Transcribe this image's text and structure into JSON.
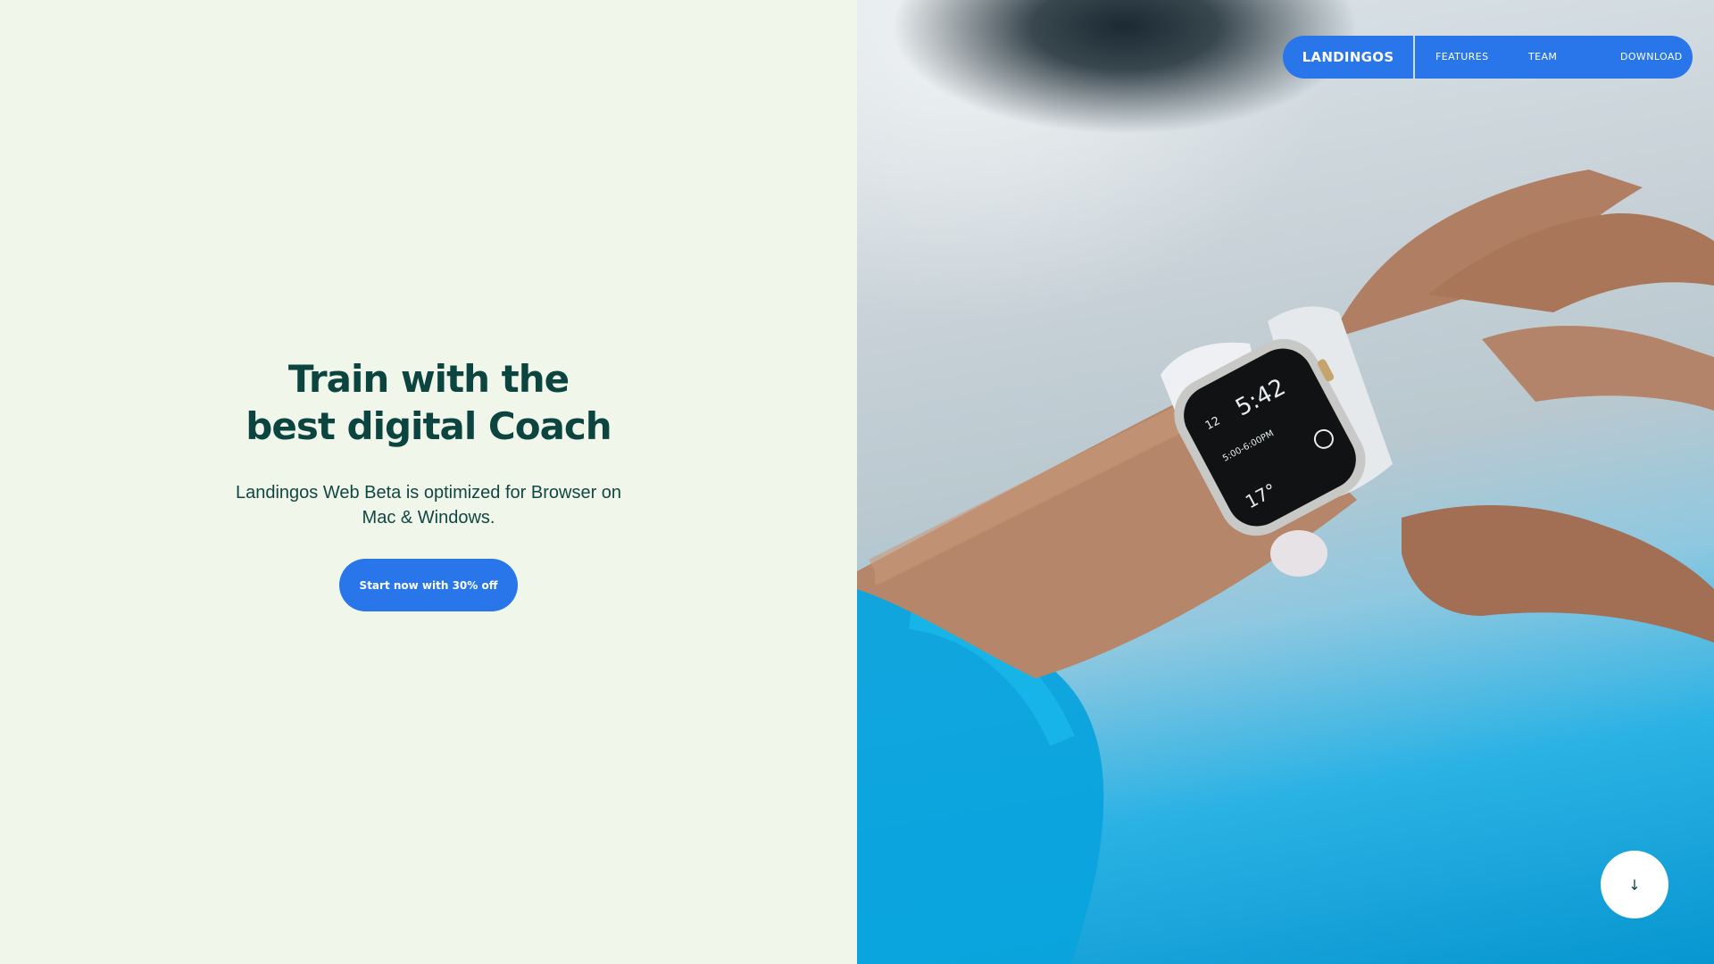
{
  "colors": {
    "left_bg": "#f1f6ea",
    "heading": "#0c4440",
    "accent": "#2876ea",
    "photo_blue": "#0796d0"
  },
  "nav": {
    "brand": "LANDINGOS",
    "features": "FEATURES",
    "team": "TEAM",
    "download": "DOWNLOAD"
  },
  "hero": {
    "title_line1": "Train with the",
    "title_line2": "best digital Coach",
    "subtitle": "Landingos Web Beta is optimized for Browser on Mac & Windows.",
    "cta": "Start now with 30% off"
  },
  "watch": {
    "time": "5:42",
    "date": "12",
    "event": "5:00-6:00PM",
    "temp": "17°"
  },
  "scroll_button": {
    "icon": "arrow-down-icon",
    "glyph": "↓"
  }
}
